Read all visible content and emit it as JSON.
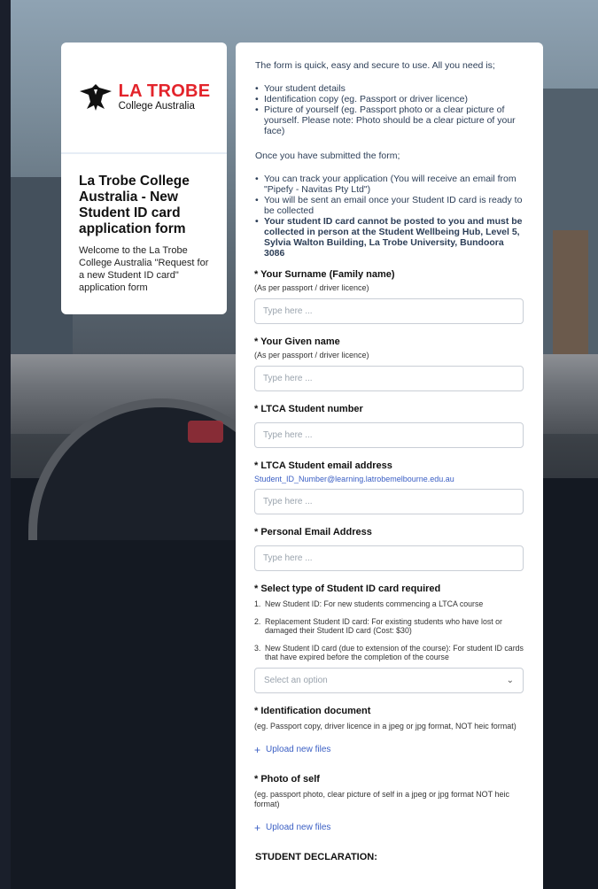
{
  "brand": {
    "name": "LA TROBE",
    "subtitle": "College Australia"
  },
  "sidebar": {
    "title": "La Trobe College Australia - New Student ID card application form",
    "description": "Welcome to the La Trobe College Australia \"Request for a new Student ID card\" application form"
  },
  "intro": {
    "lead": "The form is quick, easy and secure to use. All you need is;",
    "needs": [
      "Your student details",
      "Identification copy (eg. Passport or driver licence)",
      "Picture of yourself (eg. Passport photo or a clear picture of yourself. Please note: Photo should be a clear picture of your face)"
    ],
    "after_lead": "Once you have submitted the form;",
    "after": [
      "You can track your application (You will receive an email from \"Pipefy - Navitas Pty Ltd\")",
      "You will be sent an email once your Student ID card is ready to be collected",
      "Your student ID card cannot be posted to you and must be collected in person at the Student Wellbeing Hub, Level 5, Sylvia Walton Building, La Trobe University, Bundoora 3086"
    ]
  },
  "fields": {
    "surname": {
      "label": "* Your Surname (Family name)",
      "help": "(As per passport / driver licence)",
      "placeholder": "Type here ..."
    },
    "given": {
      "label": "* Your Given name",
      "help": "(As per passport / driver licence)",
      "placeholder": "Type here ..."
    },
    "student_number": {
      "label": "* LTCA Student number",
      "placeholder": "Type here ..."
    },
    "student_email": {
      "label": "* LTCA Student email address",
      "link": "Student_ID_Number@learning.latrobemelbourne.edu.au",
      "placeholder": "Type here ..."
    },
    "personal_email": {
      "label": "* Personal Email Address",
      "placeholder": "Type here ..."
    },
    "card_type": {
      "label": "* Select type of Student ID card required",
      "options": [
        {
          "num": "1.",
          "text": "New Student ID: For new students commencing a LTCA course"
        },
        {
          "num": "2.",
          "text": "Replacement Student ID card: For existing students who have lost or damaged their Student ID card (Cost: $30)"
        },
        {
          "num": "3.",
          "text": "New Student ID card (due to extension of the course): For student ID cards that have expired before the completion of the course"
        }
      ],
      "placeholder": "Select an option"
    },
    "id_doc": {
      "label": "* Identification document",
      "help": "(eg. Passport copy, driver licence in a jpeg or jpg format, NOT heic format)",
      "upload": "Upload new files"
    },
    "photo": {
      "label": "* Photo of self",
      "help": "(eg. passport photo, clear picture of self in a jpeg or jpg format NOT heic format)",
      "upload": "Upload new files"
    }
  },
  "declaration": {
    "label": "STUDENT DECLARATION:"
  },
  "colors": {
    "brand_red": "#e3242b",
    "link_blue": "#3b5fc4",
    "text_navy": "#2c3e57"
  }
}
